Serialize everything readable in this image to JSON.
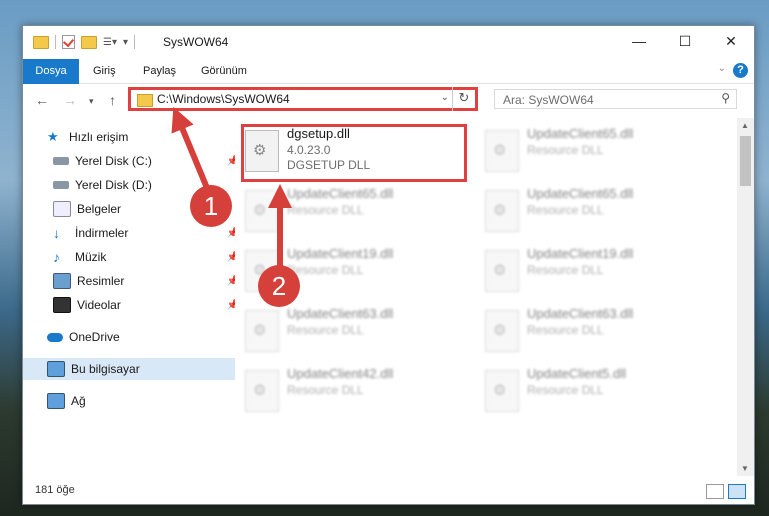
{
  "window": {
    "title": "SysWOW64"
  },
  "ribbon": {
    "tabs": [
      "Dosya",
      "Giriş",
      "Paylaş",
      "Görünüm"
    ],
    "help": "?"
  },
  "address": {
    "path": "C:\\Windows\\SysWOW64",
    "refresh": "↻",
    "dropdown": "⌄"
  },
  "search": {
    "placeholder": "Ara: SysWOW64"
  },
  "sidebar": {
    "items": [
      {
        "label": "Hızlı erişim"
      },
      {
        "label": "Yerel Disk (C:)"
      },
      {
        "label": "Yerel Disk (D:)"
      },
      {
        "label": "Belgeler"
      },
      {
        "label": "İndirmeler"
      },
      {
        "label": "Müzik"
      },
      {
        "label": "Resimler"
      },
      {
        "label": "Videolar"
      },
      {
        "label": "OneDrive"
      },
      {
        "label": "Bu bilgisayar"
      },
      {
        "label": "Ağ"
      }
    ]
  },
  "files": [
    {
      "name": "dgsetup.dll",
      "version": "4.0.23.0",
      "desc": "DGSETUP DLL"
    },
    {
      "name": "UpdateClient65.dll",
      "version": "Resource DLL"
    },
    {
      "name": "UpdateClient65.dll",
      "version": "Resource DLL"
    },
    {
      "name": "UpdateClient65.dll",
      "version": "Resource DLL"
    },
    {
      "name": "UpdateClient19.dll",
      "version": "Resource DLL"
    },
    {
      "name": "UpdateClient19.dll",
      "version": "Resource DLL"
    },
    {
      "name": "UpdateClient63.dll",
      "version": "Resource DLL"
    },
    {
      "name": "UpdateClient63.dll",
      "version": "Resource DLL"
    },
    {
      "name": "UpdateClient42.dll",
      "version": "Resource DLL"
    },
    {
      "name": "UpdateClient5.dll",
      "version": "Resource DLL"
    }
  ],
  "status": {
    "count": "181 öğe"
  },
  "annotations": {
    "step1": "1",
    "step2": "2",
    "color": "#d6403a"
  }
}
